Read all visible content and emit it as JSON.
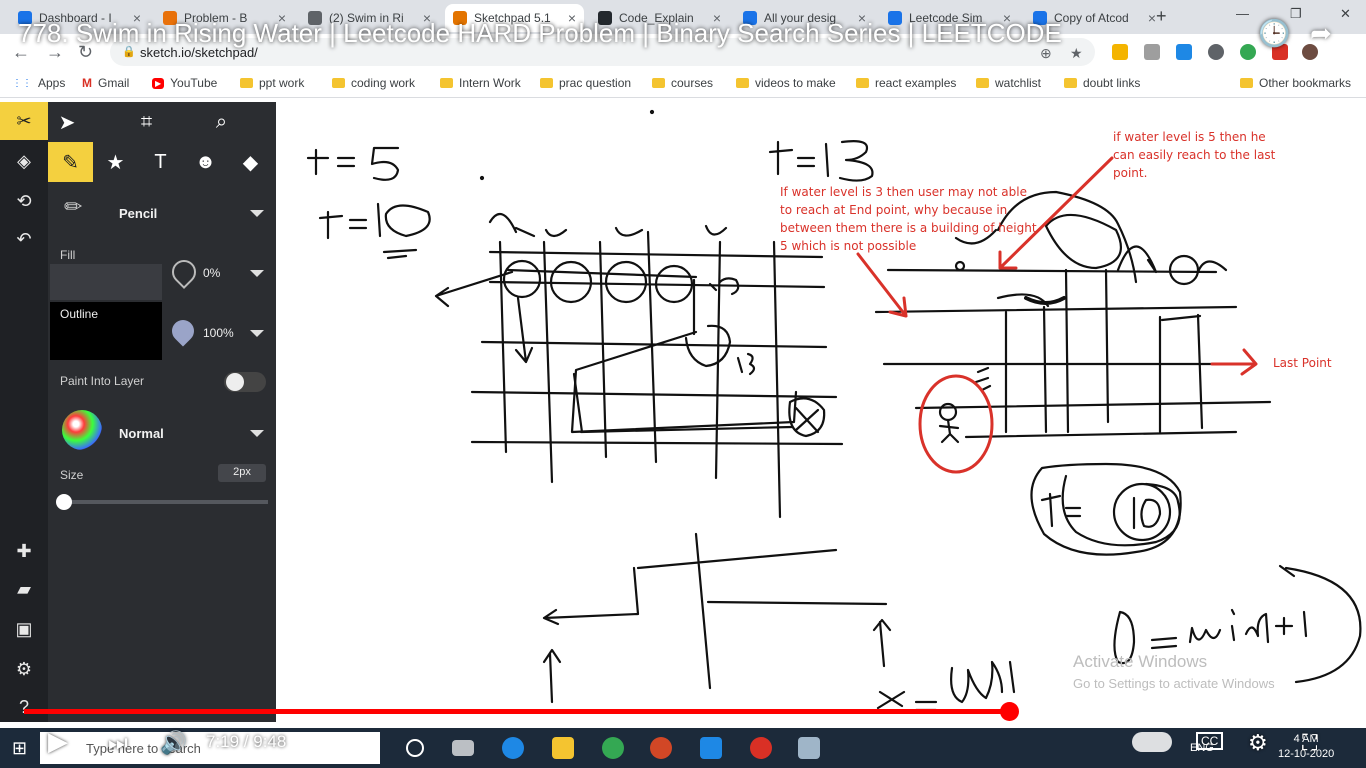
{
  "video": {
    "title": "778. Swim in Rising Water | Leetcode HARD Problem | Binary Search Series | LEETCODE",
    "current_time": "7:19",
    "duration": "9:48",
    "time_display": "7:19 / 9:48",
    "progress_fraction": 0.747
  },
  "browser": {
    "tabs": [
      {
        "label": "Dashboard - I",
        "color": "#1a73e8"
      },
      {
        "label": "Problem - B",
        "color": "#e8710a"
      },
      {
        "label": "(2) Swim in Ri",
        "color": "#5f6368"
      },
      {
        "label": "Sketchpad 5.1",
        "color": "#e37400"
      },
      {
        "label": "Code_Explain",
        "color": "#24292e"
      },
      {
        "label": "All your desig",
        "color": "#1a73e8"
      },
      {
        "label": "Leetcode Sim",
        "color": "#1a73e8"
      },
      {
        "label": "Copy of Atcod",
        "color": "#1a73e8"
      }
    ],
    "active_tab_index": 3,
    "url": "sketch.io/sketchpad/"
  },
  "bookmarks": [
    {
      "label": "Apps",
      "kind": "apps-icon"
    },
    {
      "label": "Gmail",
      "kind": "gmail-icon"
    },
    {
      "label": "YouTube",
      "kind": "youtube-icon"
    },
    {
      "label": "ppt work",
      "kind": "folder-icon"
    },
    {
      "label": "coding work",
      "kind": "folder-icon"
    },
    {
      "label": "Intern Work",
      "kind": "folder-icon"
    },
    {
      "label": "prac question",
      "kind": "folder-icon"
    },
    {
      "label": "courses",
      "kind": "folder-icon"
    },
    {
      "label": "videos to make",
      "kind": "folder-icon"
    },
    {
      "label": "react examples",
      "kind": "folder-icon"
    },
    {
      "label": "watchlist",
      "kind": "folder-icon"
    },
    {
      "label": "doubt links",
      "kind": "folder-icon"
    },
    {
      "label": "Other bookmarks",
      "kind": "folder-icon"
    }
  ],
  "sketch_panel": {
    "tool_name": "Pencil",
    "fill_label": "Fill",
    "fill_opacity": "0%",
    "outline_label": "Outline",
    "outline_opacity": "100%",
    "paint_into_layer_label": "Paint Into Layer",
    "blend_mode": "Normal",
    "size_label": "Size",
    "size_value": "2px",
    "accent_color": "#f4d03f"
  },
  "canvas": {
    "annotations": {
      "water5": "if water level is 5 then he can easily reach to the last point.",
      "water3": "If water level is 3 then user may not able to reach at End point, why because in between them there is a building of height 5 which is not possible",
      "last_point": "Last Point"
    },
    "watermark_line1": "Activate Windows",
    "watermark_line2": "Go to Settings to activate Windows"
  },
  "taskbar": {
    "search_placeholder": "Type here to search",
    "clock_time": "4 AM",
    "clock_date": "12-10-2020",
    "lang": "ENG"
  }
}
